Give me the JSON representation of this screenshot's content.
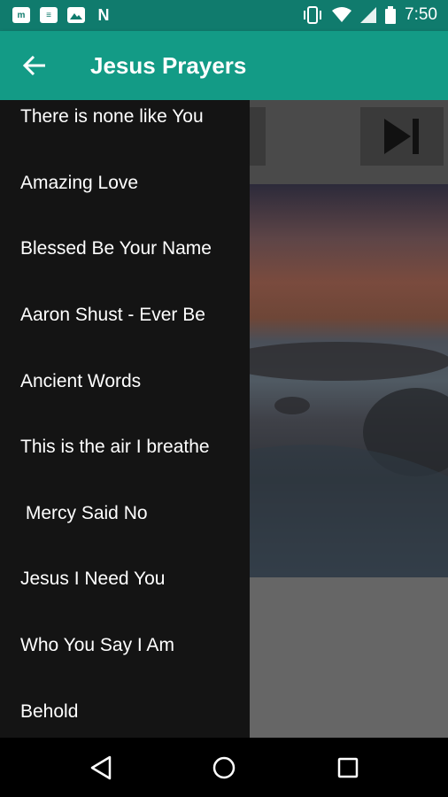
{
  "status_bar": {
    "time": "7:50",
    "left_icons": [
      "mail-icon",
      "news-icon",
      "image-icon",
      "n-app-icon"
    ],
    "right_icons": [
      "vibrate-icon",
      "wifi-icon",
      "signal-icon",
      "battery-icon"
    ]
  },
  "app_bar": {
    "title": "Jesus Prayers",
    "back_icon": "arrow-left-icon",
    "color": "#139b86"
  },
  "player": {
    "next_icon": "skip-next-icon"
  },
  "drawer": {
    "items": [
      {
        "label": "There is none like You"
      },
      {
        "label": "Amazing Love"
      },
      {
        "label": "Blessed Be Your Name"
      },
      {
        "label": "Aaron Shust - Ever Be"
      },
      {
        "label": "Ancient Words"
      },
      {
        "label": "This is the air I breathe"
      },
      {
        "label": " Mercy Said No"
      },
      {
        "label": "Jesus I Need You"
      },
      {
        "label": "Who You Say I Am"
      },
      {
        "label": "Behold"
      }
    ]
  },
  "nav_bar": {
    "back_icon": "nav-back-icon",
    "home_icon": "nav-home-icon",
    "recents_icon": "nav-recents-icon"
  }
}
